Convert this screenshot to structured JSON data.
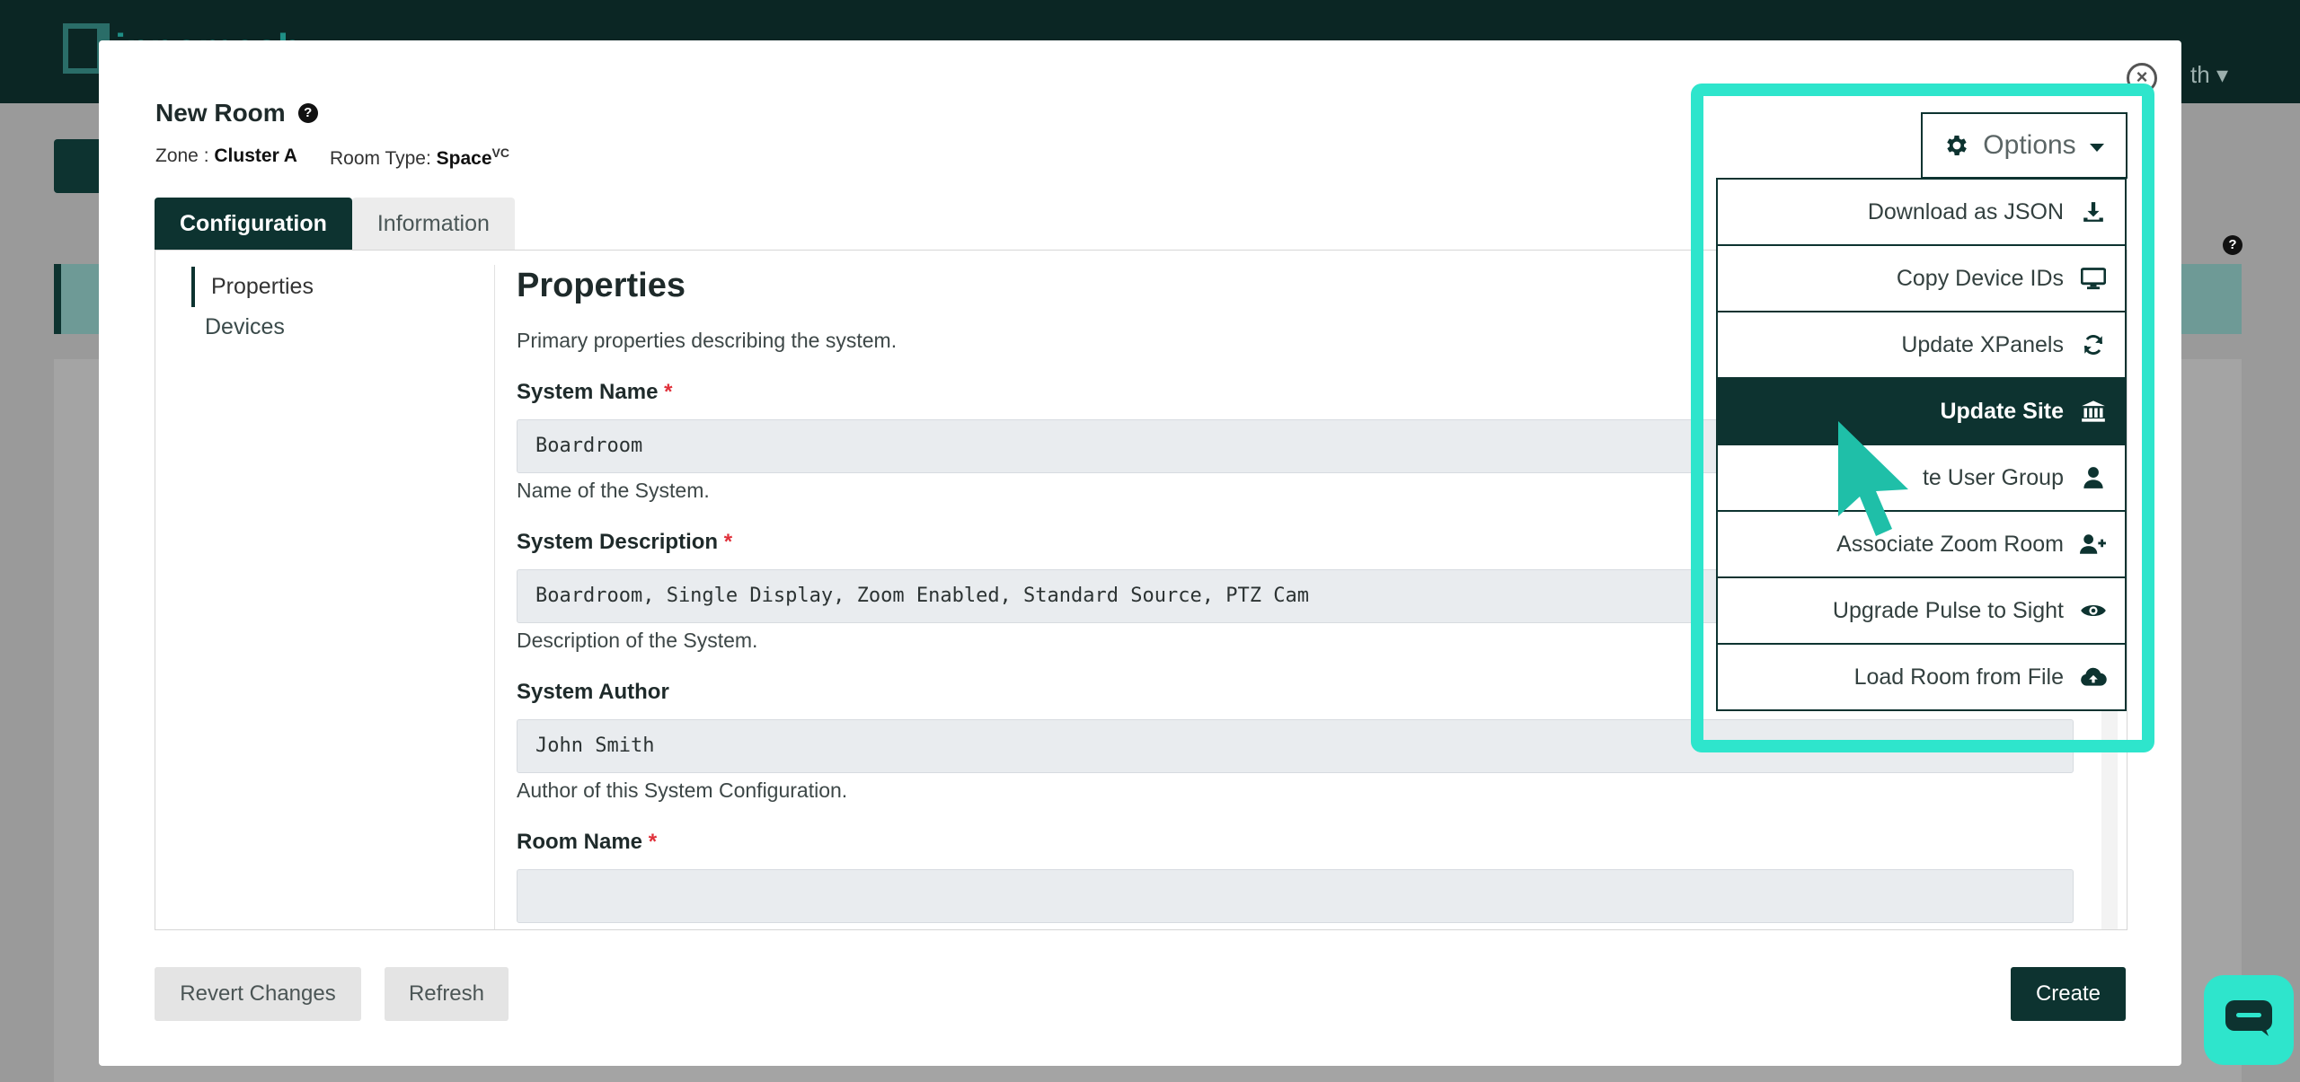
{
  "background": {
    "logo_text": "innomesh",
    "user_text": "th ▾",
    "help_glyph": "?"
  },
  "modal": {
    "title": "New Room",
    "help_glyph": "?",
    "close_glyph": "×",
    "zone_label": "Zone :",
    "zone_value": "Cluster A",
    "room_type_label": "Room Type:",
    "room_type_value": "Space",
    "room_type_sup": "VC",
    "tabs": [
      {
        "label": "Configuration",
        "active": true
      },
      {
        "label": "Information",
        "active": false
      }
    ],
    "side_nav": [
      {
        "label": "Properties",
        "active": true
      },
      {
        "label": "Devices",
        "active": false
      }
    ],
    "section_title": "Properties",
    "section_desc": "Primary properties describing the system.",
    "fields": [
      {
        "label": "System Name",
        "required": true,
        "value": "Boardroom",
        "help": "Name of the System."
      },
      {
        "label": "System Description",
        "required": true,
        "value": "Boardroom, Single Display, Zoom Enabled, Standard Source, PTZ Cam",
        "help": "Description of the System."
      },
      {
        "label": "System Author",
        "required": false,
        "value": "John Smith",
        "help": "Author of this System Configuration."
      },
      {
        "label": "Room Name",
        "required": true,
        "value": "",
        "help": ""
      }
    ],
    "required_mark": "*",
    "buttons": {
      "revert": "Revert Changes",
      "refresh": "Refresh",
      "create": "Create"
    }
  },
  "options_menu": {
    "button_label": "Options",
    "items": [
      {
        "label": "Download as JSON",
        "icon": "download-icon",
        "active": false
      },
      {
        "label": "Copy Device IDs",
        "icon": "monitor-icon",
        "active": false
      },
      {
        "label": "Update XPanels",
        "icon": "refresh-icon",
        "active": false
      },
      {
        "label": "Update Site",
        "icon": "bank-icon",
        "active": true
      },
      {
        "label": "te User Group",
        "icon": "user-icon",
        "active": false
      },
      {
        "label": "Associate Zoom Room",
        "icon": "user-plus-icon",
        "active": false
      },
      {
        "label": "Upgrade Pulse to Sight",
        "icon": "eye-icon",
        "active": false
      },
      {
        "label": "Load Room from File",
        "icon": "cloud-upload-icon",
        "active": false
      }
    ]
  },
  "colors": {
    "brand_dark": "#0d3330",
    "highlight": "#2ee5cc",
    "required": "#e0303a"
  }
}
